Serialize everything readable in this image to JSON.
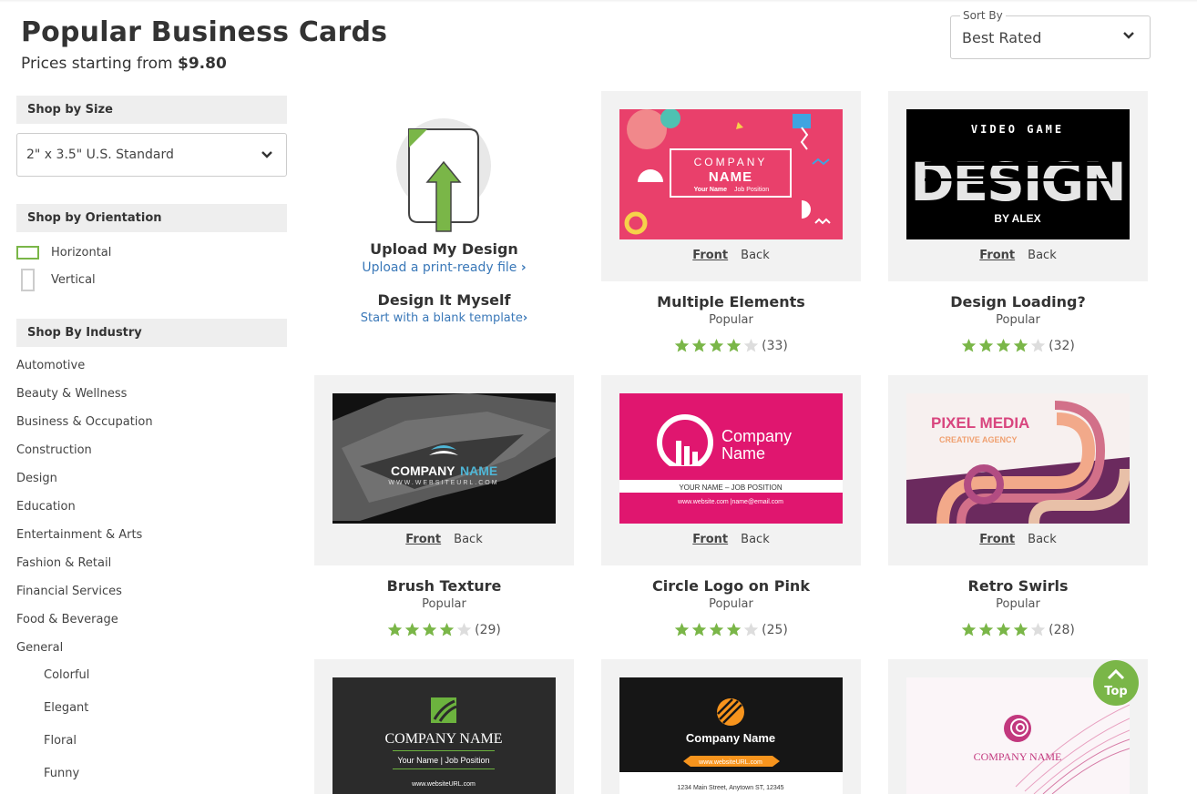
{
  "header": {
    "title": "Popular Business Cards",
    "subtitle_prefix": "Prices starting from",
    "subtitle_price": "$9.80"
  },
  "sort": {
    "legend": "Sort By",
    "value": "Best Rated"
  },
  "sidebar": {
    "size_heading": "Shop by Size",
    "size_value": "2\" x 3.5\" U.S. Standard",
    "orientation_heading": "Shop by Orientation",
    "orientation_options": [
      "Horizontal",
      "Vertical"
    ],
    "industry_heading": "Shop By Industry",
    "industries": [
      "Automotive",
      "Beauty & Wellness",
      "Business & Occupation",
      "Construction",
      "Design",
      "Education",
      "Entertainment & Arts",
      "Fashion & Retail",
      "Financial Services",
      "Food & Beverage",
      "General"
    ],
    "general_subitems": [
      "Colorful",
      "Elegant",
      "Floral",
      "Funny"
    ]
  },
  "upload": {
    "title": "Upload My Design",
    "link": "Upload a print-ready file",
    "diy_title": "Design It Myself",
    "diy_link": "Start with a blank template"
  },
  "tile_labels": {
    "front": "Front",
    "back": "Back"
  },
  "designs": [
    {
      "name": "Multiple Elements",
      "tag": "Popular",
      "rating": 4,
      "count": "(33)",
      "card_text": {
        "line1": "COMPANY",
        "line2": "NAME",
        "line3": "Your Name",
        "line4": "Job Position"
      }
    },
    {
      "name": "Design Loading?",
      "tag": "Popular",
      "rating": 4,
      "count": "(32)",
      "card_text": {
        "line1": "VIDEO GAME",
        "line2": "DESIGN",
        "line3": "BY ALEX"
      }
    },
    {
      "name": "Brush Texture",
      "tag": "Popular",
      "rating": 4,
      "count": "(29)",
      "card_text": {
        "line1": "COMPANY",
        "line2": "NAME",
        "line3": "WWW.WEBSITEURL.COM"
      }
    },
    {
      "name": "Circle Logo on Pink",
      "tag": "Popular",
      "rating": 4,
      "count": "(25)",
      "card_text": {
        "line1": "Company",
        "line2": "Name",
        "line3": "YOUR NAME    – JOB POSITION",
        "line4": "www.website.com   |name@email.com"
      }
    },
    {
      "name": "Retro Swirls",
      "tag": "Popular",
      "rating": 4,
      "count": "(28)",
      "card_text": {
        "line1": "PIXEL MEDIA",
        "line2": "CREATIVE AGENCY"
      }
    }
  ],
  "partial_cards": [
    {
      "line1": "COMPANY NAME",
      "line2": "Your Name | Job Position",
      "line3": "www.websiteURL.com"
    },
    {
      "line1": "Company Name",
      "line2": "www.websiteURL.com",
      "line3": "1234 Main Street, Anytown ST, 12345"
    },
    {
      "line1": "COMPANY NAME"
    }
  ],
  "top_button": "Top",
  "colors": {
    "accent_green": "#7ab648",
    "link_blue": "#3a78b8",
    "star_green": "#7ab648",
    "star_empty": "#dddddd"
  }
}
